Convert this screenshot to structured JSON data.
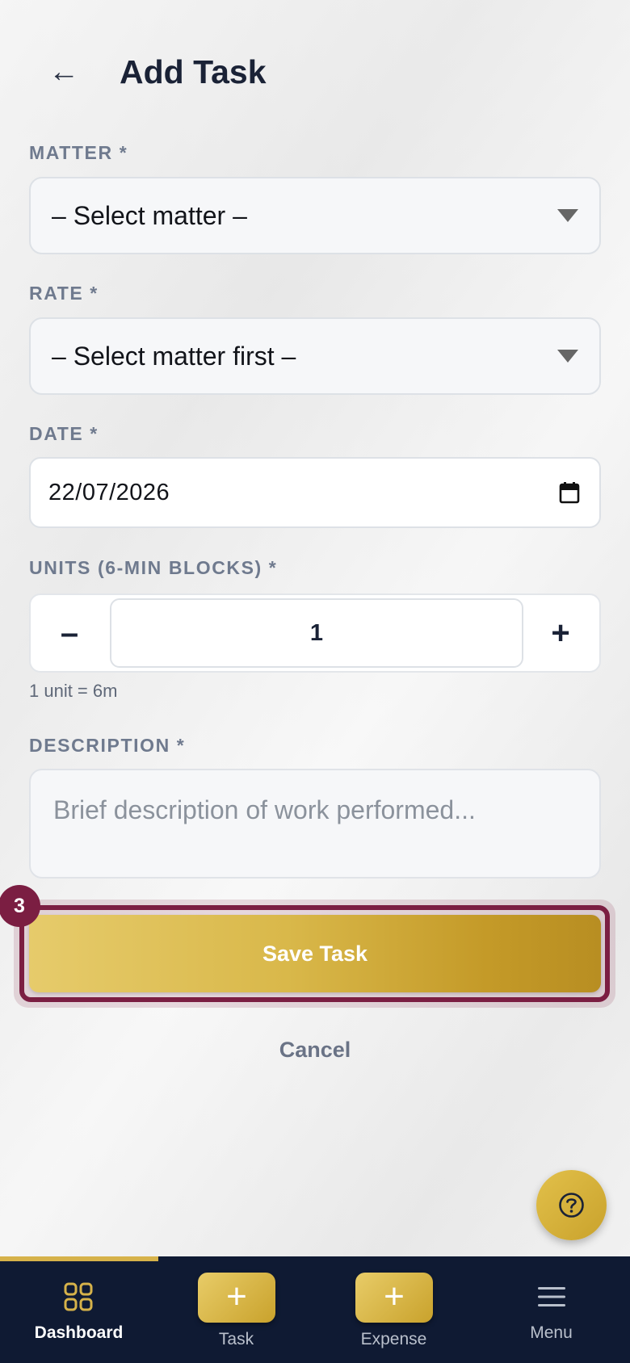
{
  "header": {
    "back_icon": "←",
    "title": "Add Task"
  },
  "form": {
    "matter": {
      "label": "MATTER *",
      "value": "– Select matter –"
    },
    "rate": {
      "label": "RATE *",
      "value": "– Select matter first –"
    },
    "date": {
      "label": "DATE *",
      "value": "22/07/2026"
    },
    "units": {
      "label": "UNITS (6-MIN BLOCKS) *",
      "minus": "–",
      "plus": "+",
      "value": "1",
      "hint": "1 unit = 6m"
    },
    "description": {
      "label": "DESCRIPTION *",
      "placeholder": "Brief description of work performed..."
    },
    "save_label": "Save Task",
    "cancel_label": "Cancel",
    "step_badge": "3"
  },
  "help": {
    "icon": "question-icon"
  },
  "bottom_nav": {
    "items": [
      {
        "label": "Dashboard",
        "icon": "grid-icon",
        "active": true
      },
      {
        "label": "Task",
        "icon": "plus-icon",
        "active": false
      },
      {
        "label": "Expense",
        "icon": "plus-icon",
        "active": false
      },
      {
        "label": "Menu",
        "icon": "hamburger-icon",
        "active": false
      }
    ]
  },
  "colors": {
    "navy": "#0f1a33",
    "gold": "#d6b24a",
    "highlight": "#7b1e42"
  }
}
